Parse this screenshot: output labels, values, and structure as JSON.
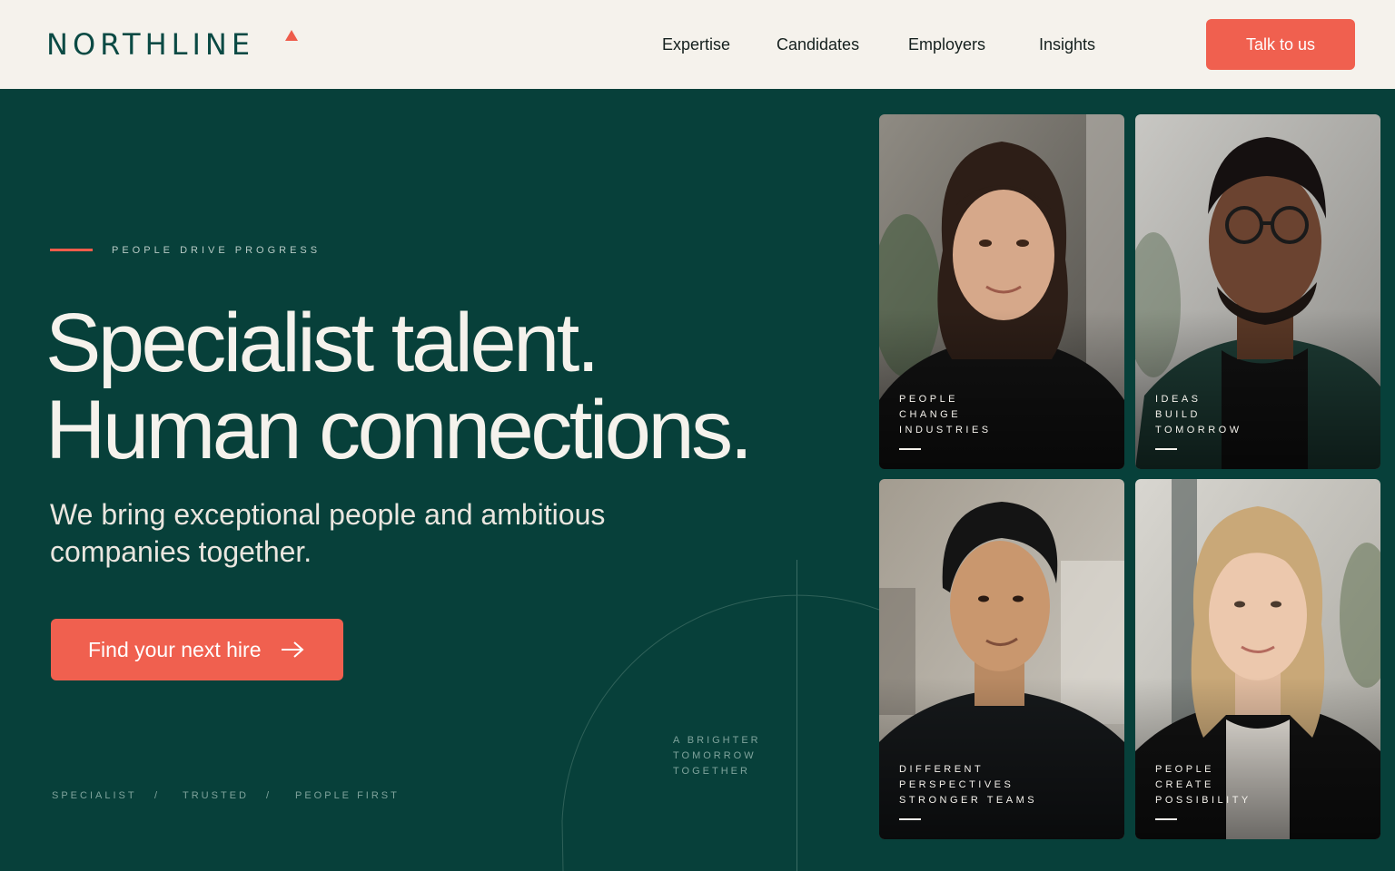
{
  "header": {
    "logo": "NORTHLINE",
    "nav": [
      "Expertise",
      "Candidates",
      "Employers",
      "Insights"
    ],
    "cta_label": "Talk to us"
  },
  "hero": {
    "eyebrow": "PEOPLE DRIVE PROGRESS",
    "headline": [
      "Specialist talent.",
      "Human connections."
    ],
    "subhead": "We bring exceptional people and ambitious companies together.",
    "cta_label": "Find your next hire",
    "tags": [
      "SPECIALIST",
      "/",
      "TRUSTED",
      "/",
      "PEOPLE FIRST"
    ],
    "decor_text": [
      "A BRIGHTER",
      "TOMORROW",
      "TOGETHER"
    ]
  },
  "cards": [
    {
      "caption": [
        "PEOPLE",
        "CHANGE",
        "INDUSTRIES"
      ]
    },
    {
      "caption": [
        "IDEAS",
        "BUILD",
        "TOMORROW"
      ]
    },
    {
      "caption": [
        "DIFFERENT",
        "PERSPECTIVES",
        "STRONGER TEAMS"
      ]
    },
    {
      "caption": [
        "PEOPLE",
        "CREATE",
        "POSSIBILITY"
      ]
    }
  ],
  "colors": {
    "accent": "#f0604f",
    "background": "#07403a",
    "header_bg": "#f5f2ec",
    "brand_text": "#0b4a44"
  },
  "icons": {
    "logo_mark": "triangle-icon",
    "cta_arrow": "arrow-right-icon"
  }
}
